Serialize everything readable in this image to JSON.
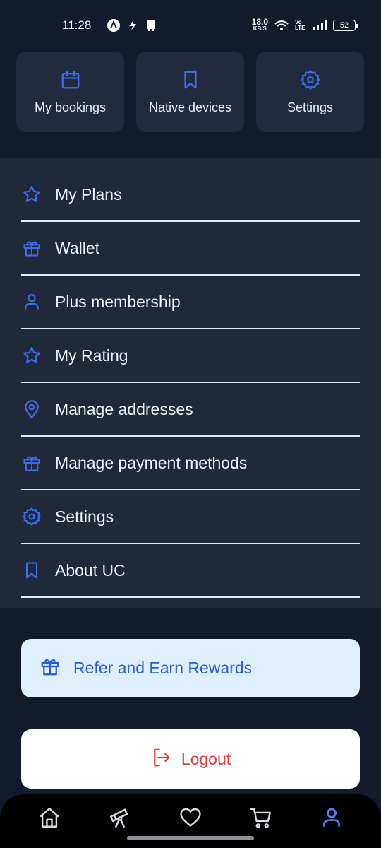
{
  "status_bar": {
    "time": "11:28",
    "net_speed": "18.0",
    "net_unit": "KB/S",
    "volte": "Vo LTE",
    "battery": "52"
  },
  "quick_actions": [
    {
      "label": "My bookings",
      "icon": "calendar-icon"
    },
    {
      "label": "Native devices",
      "icon": "bookmark-icon"
    },
    {
      "label": "Settings",
      "icon": "gear-icon"
    }
  ],
  "menu": [
    {
      "label": "My Plans",
      "icon": "star-icon"
    },
    {
      "label": "Wallet",
      "icon": "gift-icon"
    },
    {
      "label": "Plus membership",
      "icon": "user-icon"
    },
    {
      "label": "My Rating",
      "icon": "star-icon"
    },
    {
      "label": "Manage addresses",
      "icon": "location-pin-icon"
    },
    {
      "label": "Manage payment methods",
      "icon": "gift-icon"
    },
    {
      "label": "Settings",
      "icon": "gear-icon"
    },
    {
      "label": "About UC",
      "icon": "bookmark-icon"
    }
  ],
  "refer": {
    "label": "Refer and Earn Rewards",
    "icon": "gift-icon"
  },
  "logout": {
    "label": "Logout",
    "icon": "logout-icon"
  },
  "bottom_nav": [
    {
      "name": "home",
      "icon": "home-icon",
      "active": false
    },
    {
      "name": "explore",
      "icon": "telescope-icon",
      "active": false
    },
    {
      "name": "favorites",
      "icon": "heart-icon",
      "active": false
    },
    {
      "name": "cart",
      "icon": "cart-icon",
      "active": false
    },
    {
      "name": "profile",
      "icon": "user-icon",
      "active": true
    }
  ],
  "colors": {
    "background": "#121a2b",
    "panel": "#1f2939",
    "card": "#212b3d",
    "accent": "#3a6df0",
    "refer_bg": "#dff0fc",
    "refer_text": "#2a5bd7",
    "logout_text": "#e0403a"
  }
}
